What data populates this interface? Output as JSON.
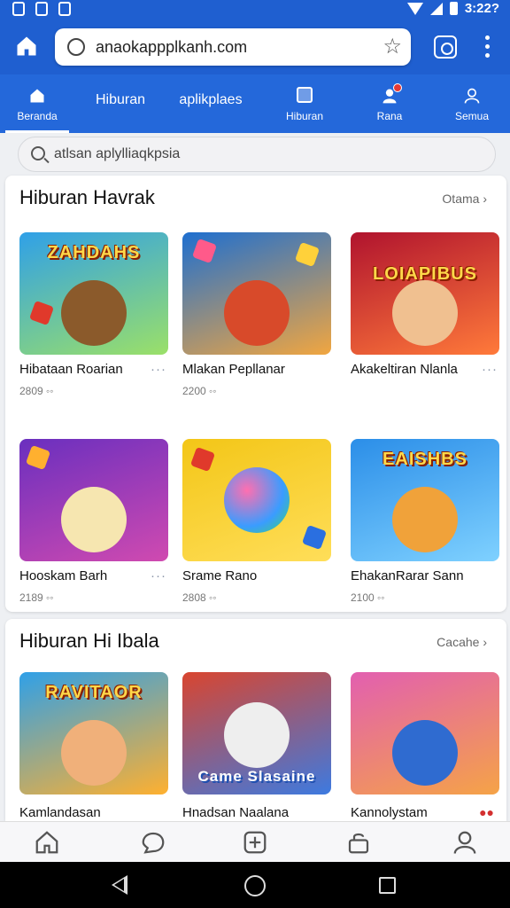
{
  "status_bar": {
    "time": "3:22?"
  },
  "browser": {
    "url": "anaokappplkanh.com",
    "icons": [
      "home-icon",
      "info-icon",
      "star-icon",
      "tabs-icon",
      "more-vert-icon"
    ]
  },
  "nav_tabs": [
    {
      "label": "Beranda",
      "icon": "home-icon",
      "active": true
    },
    {
      "label": "Hiburan"
    },
    {
      "label": "aplikplaes"
    },
    {
      "label": "Hiburan",
      "icon": "square-icon"
    },
    {
      "label": "Rana",
      "icon": "user-notify-icon",
      "badge": true
    },
    {
      "label": "Semua",
      "icon": "person-icon"
    }
  ],
  "search": {
    "placeholder": "atlsan aplylliaqkpsia"
  },
  "section1": {
    "title": "Hiburan Havrak",
    "more": "Otama",
    "cards": [
      {
        "thumb_text": "ZAHDAHS",
        "title": "Hibataan Roarian",
        "meta": "2809 ◦◦",
        "colors": [
          "#2fa0e8",
          "#9be068"
        ]
      },
      {
        "thumb_text": "",
        "title": "Mlakan Pepllanar",
        "meta": "2200 ◦◦",
        "colors": [
          "#1e6fd0",
          "#f1a640"
        ]
      },
      {
        "thumb_text": "LOIAPIBUS",
        "title": "Akakeltiran Nlanla",
        "meta": "",
        "colors": [
          "#b0132e",
          "#ff7a3a"
        ]
      },
      {
        "thumb_text": "",
        "title": "Hooskam Barh",
        "meta": "2189 ◦◦",
        "colors": [
          "#6a2fbf",
          "#d04ab0"
        ]
      },
      {
        "thumb_text": "",
        "title": "Srame Rano",
        "meta": "2808 ◦◦",
        "colors": [
          "#f3c617",
          "#ffde59"
        ]
      },
      {
        "thumb_text": "EAISHBS",
        "title": "EhakanRarar Sann",
        "meta": "2100 ◦◦",
        "colors": [
          "#2b8ee8",
          "#7fd1ff"
        ]
      }
    ]
  },
  "section2": {
    "title": "Hiburan Hi Ibala",
    "more": "Cacahe",
    "cards": [
      {
        "thumb_text": "RAVITAOR",
        "title": "Kamlandasan",
        "colors": [
          "#2fa0e8",
          "#ffb02f"
        ]
      },
      {
        "thumb_text": "Came Slasaine",
        "title": "Hnadsan Naalana",
        "colors": [
          "#d9452f",
          "#3d7ae0"
        ]
      },
      {
        "thumb_text": "",
        "title": "Kannolystam",
        "colors": [
          "#e25fb0",
          "#f5a347"
        ]
      }
    ]
  },
  "bottom_nav": [
    "home-icon",
    "chat-icon",
    "add-icon",
    "lock-icon",
    "profile-icon"
  ],
  "system_nav": [
    "back-icon",
    "home-circle-icon",
    "recents-icon"
  ]
}
